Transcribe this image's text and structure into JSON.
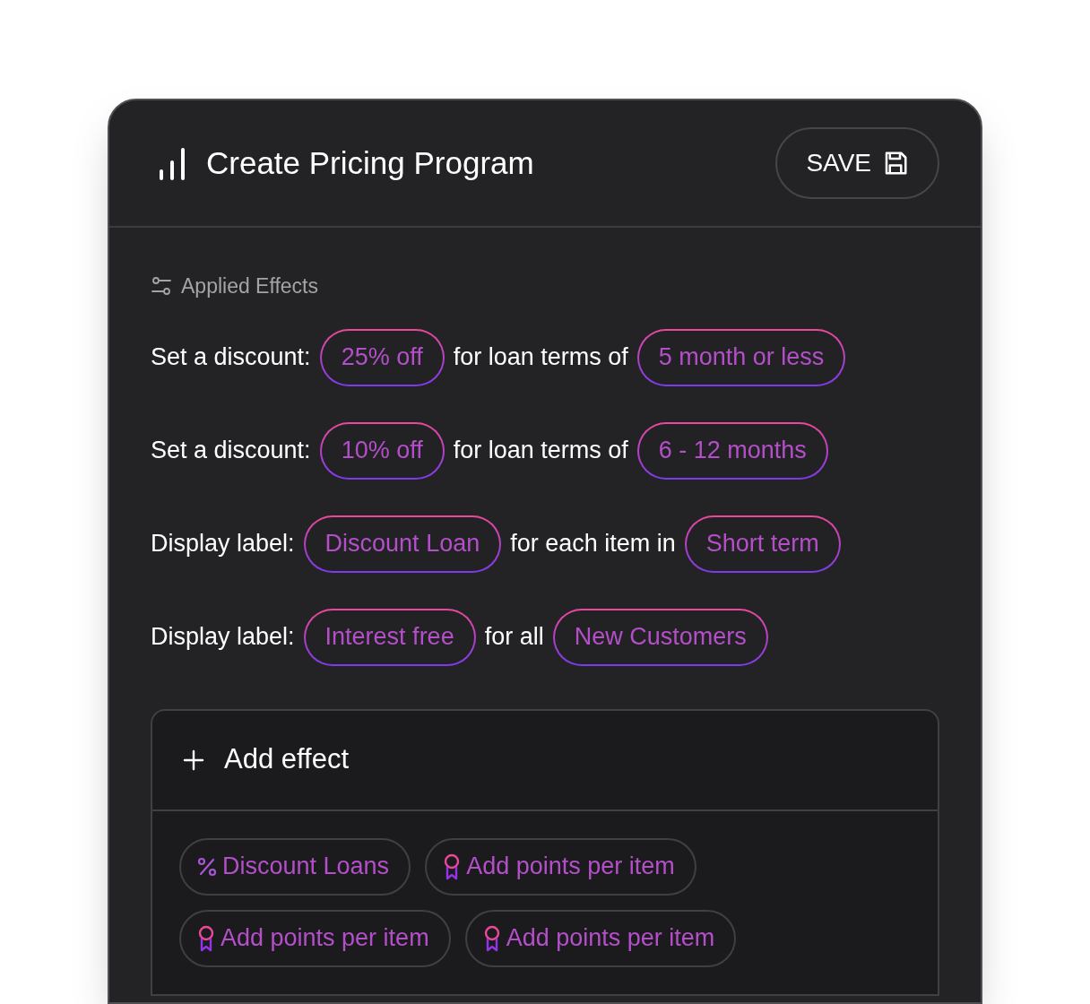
{
  "header": {
    "title": "Create Pricing Program",
    "save_button": "SAVE"
  },
  "section_label": "Applied Effects",
  "effects": [
    {
      "parts": [
        {
          "kind": "text",
          "text": "Set a discount:"
        },
        {
          "kind": "pill",
          "text": "25% off"
        },
        {
          "kind": "text",
          "text": "for loan terms of"
        },
        {
          "kind": "pill",
          "text": "5 month or less"
        }
      ]
    },
    {
      "parts": [
        {
          "kind": "text",
          "text": "Set a discount:"
        },
        {
          "kind": "pill",
          "text": "10% off"
        },
        {
          "kind": "text",
          "text": "for loan terms of"
        },
        {
          "kind": "pill",
          "text": "6 - 12 months"
        }
      ]
    },
    {
      "parts": [
        {
          "kind": "text",
          "text": "Display label:"
        },
        {
          "kind": "pill",
          "text": "Discount Loan"
        },
        {
          "kind": "text",
          "text": "for each item in"
        },
        {
          "kind": "pill",
          "text": "Short term"
        }
      ]
    },
    {
      "parts": [
        {
          "kind": "text",
          "text": "Display label:"
        },
        {
          "kind": "pill",
          "text": "Interest free"
        },
        {
          "kind": "text",
          "text": "for all"
        },
        {
          "kind": "pill",
          "text": "New Customers"
        }
      ]
    }
  ],
  "add_effect": {
    "label": "Add effect",
    "suggestions": [
      {
        "kind": "percent",
        "label": "Discount Loans"
      },
      {
        "kind": "award",
        "label": "Add points per item"
      },
      {
        "kind": "award",
        "label": "Add points per item"
      },
      {
        "kind": "award",
        "label": "Add points per item"
      }
    ]
  }
}
